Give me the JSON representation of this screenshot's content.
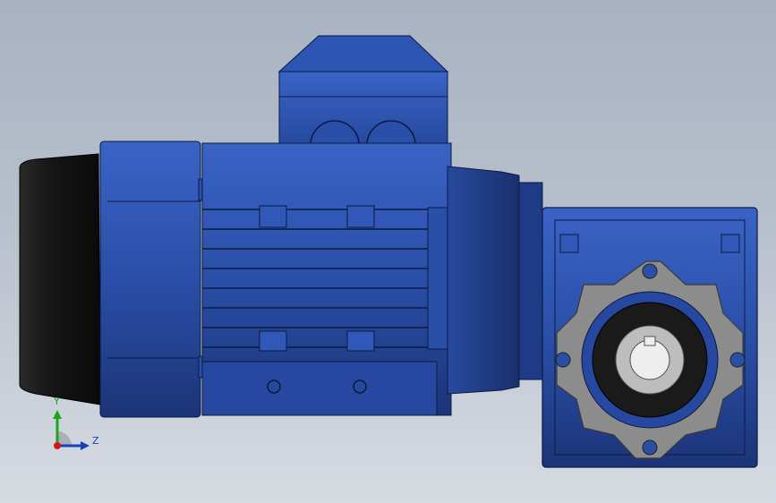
{
  "viewport": {
    "background_top": "#a8b2c2",
    "background_bottom": "#d6dbe2"
  },
  "model": {
    "subject": "geared-motor-with-worm-gearbox",
    "colors": {
      "body_blue": "#2a4fa8",
      "body_dark": "#1c3478",
      "fan_cover": "#1a1a1a",
      "flange_gray": "#8c8c8c",
      "bore_gray": "#bdbdbd"
    }
  },
  "triad": {
    "y_label": "Y",
    "z_label": "Z",
    "y_color": "#1ea51e",
    "z_color": "#1b3fb8",
    "origin_color": "#d01818"
  }
}
